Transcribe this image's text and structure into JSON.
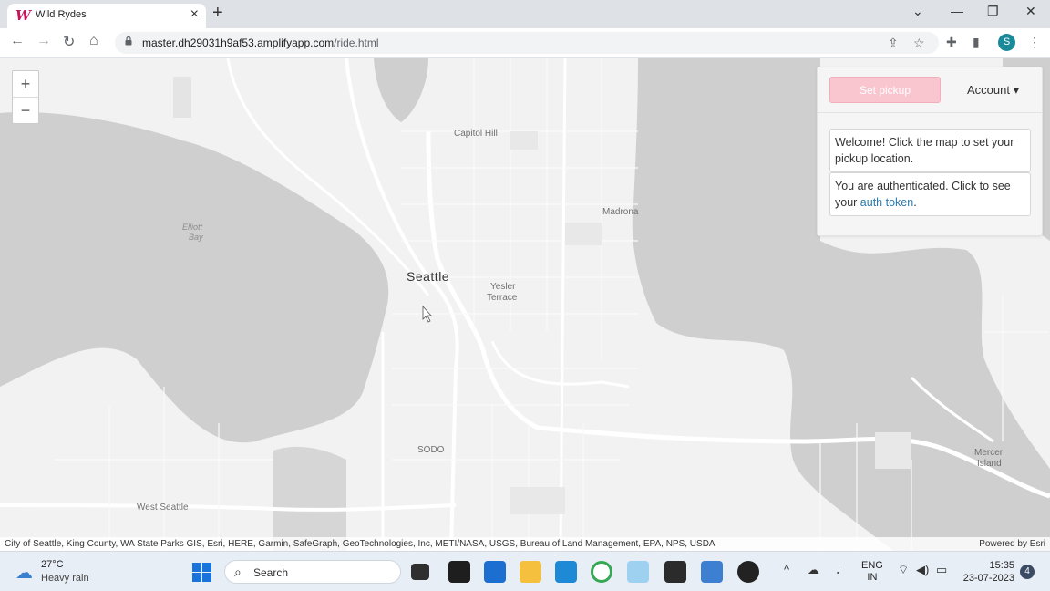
{
  "browser": {
    "tab_title": "Wild Rydes",
    "favicon": "W",
    "url_host": "master.dh29031h9af53.amplifyapp.com",
    "url_path": "/ride.html",
    "profile_initial": "S"
  },
  "map": {
    "zoom_in": "+",
    "zoom_out": "−",
    "labels": {
      "capitol_hill": "Capitol Hill",
      "elliott_bay_1": "Elliott",
      "elliott_bay_2": "Bay",
      "madrona": "Madrona",
      "seattle": "Seattle",
      "yesler_1": "Yesler",
      "yesler_2": "Terrace",
      "sodo": "SODO",
      "west_seattle": "West Seattle",
      "mercer_1": "Mercer",
      "mercer_2": "Island"
    },
    "attribution": "City of Seattle, King County, WA State Parks GIS, Esri, HERE, Garmin, SafeGraph, GeoTechnologies, Inc, METI/NASA, USGS, Bureau of Land Management, EPA, NPS, USDA",
    "powered_by": "Powered by Esri"
  },
  "panel": {
    "pickup_button": "Set pickup",
    "account": "Account ▾",
    "welcome": "Welcome! Click the map to set your pickup location.",
    "auth_prefix": "You are authenticated. Click to see your ",
    "auth_link": "auth token",
    "auth_suffix": "."
  },
  "taskbar": {
    "temperature": "27°C",
    "weather": "Heavy rain",
    "search": "Search",
    "lang_1": "ENG",
    "lang_2": "IN",
    "time": "15:35",
    "date": "23-07-2023",
    "notifications": "4"
  },
  "colors": {
    "accent_pink": "#f9c5cf",
    "link": "#2a7ab0",
    "water": "#cfcfcf",
    "land": "#f2f2f2"
  }
}
